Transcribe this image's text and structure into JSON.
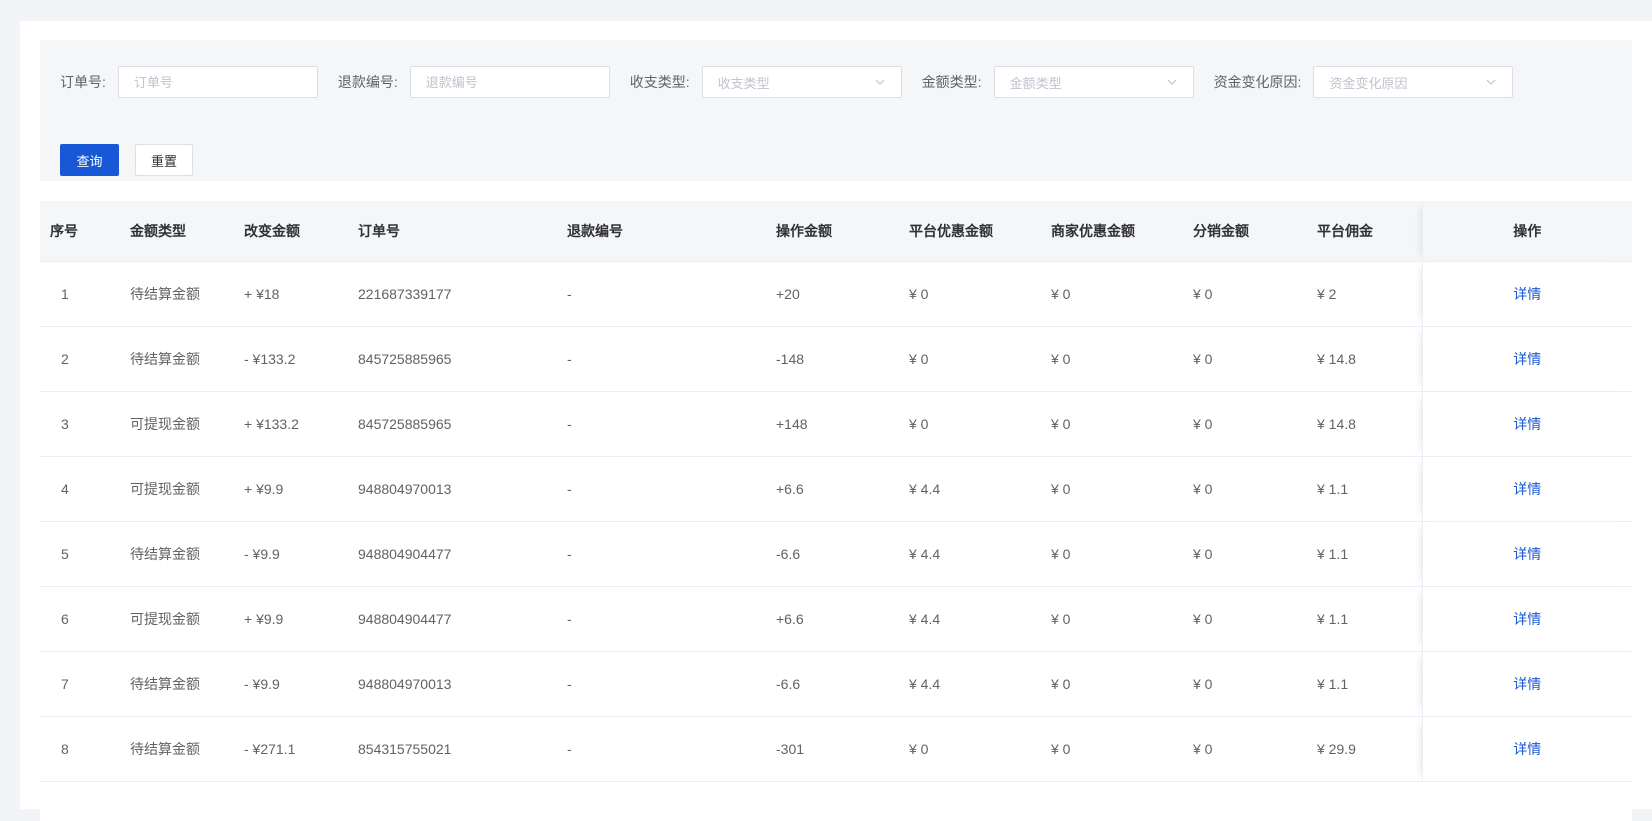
{
  "filters": [
    {
      "label": "订单号:",
      "placeholder": "订单号",
      "kind": "input"
    },
    {
      "label": "退款编号:",
      "placeholder": "退款编号",
      "kind": "input"
    },
    {
      "label": "收支类型:",
      "placeholder": "收支类型",
      "kind": "select"
    },
    {
      "label": "金额类型:",
      "placeholder": "金额类型",
      "kind": "select"
    },
    {
      "label": "资金变化原因:",
      "placeholder": "资金变化原因",
      "kind": "select"
    }
  ],
  "buttons": {
    "query": "查询",
    "reset": "重置"
  },
  "table": {
    "headers": {
      "index": "序号",
      "amount_type": "金额类型",
      "change_amount": "改变金额",
      "order_no": "订单号",
      "refund_no": "退款编号",
      "op_amount": "操作金额",
      "platform_discount": "平台优惠金额",
      "merchant_discount": "商家优惠金额",
      "distribution": "分销金额",
      "commission": "平台佣金",
      "action": "操作"
    },
    "action_label": "详情",
    "rows": [
      {
        "index": "1",
        "amount_type": "待结算金额",
        "change_amount": "+ ¥18",
        "order_no": "221687339177",
        "refund_no": "-",
        "op_amount": "+20",
        "platform_discount": "¥ 0",
        "merchant_discount": "¥ 0",
        "distribution": "¥ 0",
        "commission": "¥ 2"
      },
      {
        "index": "2",
        "amount_type": "待结算金额",
        "change_amount": "- ¥133.2",
        "order_no": "845725885965",
        "refund_no": "-",
        "op_amount": "-148",
        "platform_discount": "¥ 0",
        "merchant_discount": "¥ 0",
        "distribution": "¥ 0",
        "commission": "¥ 14.8"
      },
      {
        "index": "3",
        "amount_type": "可提现金额",
        "change_amount": "+ ¥133.2",
        "order_no": "845725885965",
        "refund_no": "-",
        "op_amount": "+148",
        "platform_discount": "¥ 0",
        "merchant_discount": "¥ 0",
        "distribution": "¥ 0",
        "commission": "¥ 14.8"
      },
      {
        "index": "4",
        "amount_type": "可提现金额",
        "change_amount": "+ ¥9.9",
        "order_no": "948804970013",
        "refund_no": "-",
        "op_amount": "+6.6",
        "platform_discount": "¥ 4.4",
        "merchant_discount": "¥ 0",
        "distribution": "¥ 0",
        "commission": "¥ 1.1"
      },
      {
        "index": "5",
        "amount_type": "待结算金额",
        "change_amount": "- ¥9.9",
        "order_no": "948804904477",
        "refund_no": "-",
        "op_amount": "-6.6",
        "platform_discount": "¥ 4.4",
        "merchant_discount": "¥ 0",
        "distribution": "¥ 0",
        "commission": "¥ 1.1"
      },
      {
        "index": "6",
        "amount_type": "可提现金额",
        "change_amount": "+ ¥9.9",
        "order_no": "948804904477",
        "refund_no": "-",
        "op_amount": "+6.6",
        "platform_discount": "¥ 4.4",
        "merchant_discount": "¥ 0",
        "distribution": "¥ 0",
        "commission": "¥ 1.1"
      },
      {
        "index": "7",
        "amount_type": "待结算金额",
        "change_amount": "- ¥9.9",
        "order_no": "948804970013",
        "refund_no": "-",
        "op_amount": "-6.6",
        "platform_discount": "¥ 4.4",
        "merchant_discount": "¥ 0",
        "distribution": "¥ 0",
        "commission": "¥ 1.1"
      },
      {
        "index": "8",
        "amount_type": "待结算金额",
        "change_amount": "- ¥271.1",
        "order_no": "854315755021",
        "refund_no": "-",
        "op_amount": "-301",
        "platform_discount": "¥ 0",
        "merchant_discount": "¥ 0",
        "distribution": "¥ 0",
        "commission": "¥ 29.9"
      }
    ]
  }
}
